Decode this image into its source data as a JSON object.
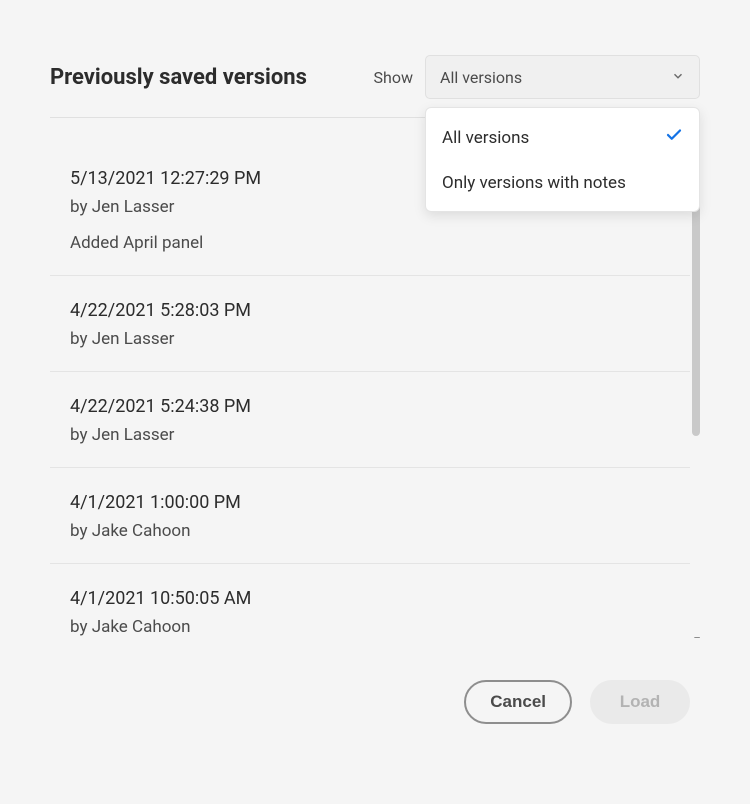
{
  "title": "Previously saved versions",
  "show_label": "Show",
  "dropdown": {
    "selected": "All versions",
    "options": [
      {
        "label": "All versions",
        "selected": true
      },
      {
        "label": "Only versions with notes",
        "selected": false
      }
    ]
  },
  "versions": [
    {
      "timestamp": "5/13/2021 12:27:29 PM",
      "author": "by Jen Lasser",
      "note": "Added April panel"
    },
    {
      "timestamp": "4/22/2021 5:28:03 PM",
      "author": "by Jen Lasser",
      "note": ""
    },
    {
      "timestamp": "4/22/2021 5:24:38 PM",
      "author": "by Jen Lasser",
      "note": ""
    },
    {
      "timestamp": "4/1/2021 1:00:00 PM",
      "author": "by Jake Cahoon",
      "note": ""
    },
    {
      "timestamp": "4/1/2021 10:50:05 AM",
      "author": "by Jake Cahoon",
      "note": ""
    }
  ],
  "buttons": {
    "cancel": "Cancel",
    "load": "Load"
  }
}
